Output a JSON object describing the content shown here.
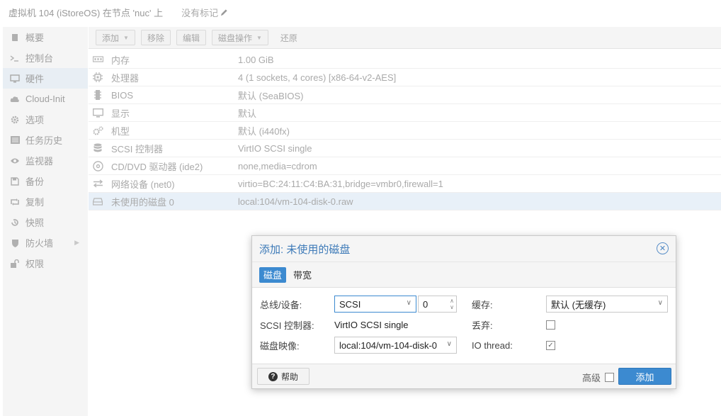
{
  "window": {
    "title": "虚拟机 104 (iStoreOS) 在节点 'nuc' 上",
    "tag_label": "没有标记"
  },
  "sidebar": {
    "items": [
      {
        "label": "概要",
        "icon": "book-icon"
      },
      {
        "label": "控制台",
        "icon": "terminal-icon"
      },
      {
        "label": "硬件",
        "icon": "monitor-icon"
      },
      {
        "label": "Cloud-Init",
        "icon": "cloud-icon"
      },
      {
        "label": "选项",
        "icon": "gear-icon"
      },
      {
        "label": "任务历史",
        "icon": "list-icon"
      },
      {
        "label": "监视器",
        "icon": "eye-icon"
      },
      {
        "label": "备份",
        "icon": "floppy-icon"
      },
      {
        "label": "复制",
        "icon": "retweet-icon"
      },
      {
        "label": "快照",
        "icon": "history-icon"
      },
      {
        "label": "防火墙",
        "icon": "shield-icon"
      },
      {
        "label": "权限",
        "icon": "unlock-icon"
      }
    ],
    "active": "硬件"
  },
  "toolbar": {
    "add_label": "添加",
    "remove_label": "移除",
    "edit_label": "编辑",
    "disk_action_label": "磁盘操作",
    "revert_label": "还原"
  },
  "hardware": {
    "rows": [
      {
        "name": "内存",
        "value": "1.00 GiB",
        "icon": "memory-icon"
      },
      {
        "name": "处理器",
        "value": "4 (1 sockets, 4 cores) [x86-64-v2-AES]",
        "icon": "cpu-icon"
      },
      {
        "name": "BIOS",
        "value": "默认 (SeaBIOS)",
        "icon": "microchip-icon"
      },
      {
        "name": "显示",
        "value": "默认",
        "icon": "desktop-icon"
      },
      {
        "name": "机型",
        "value": "默认 (i440fx)",
        "icon": "cogs-icon"
      },
      {
        "name": "SCSI 控制器",
        "value": "VirtIO SCSI single",
        "icon": "database-icon"
      },
      {
        "name": "CD/DVD 驱动器 (ide2)",
        "value": "none,media=cdrom",
        "icon": "cdrom-icon"
      },
      {
        "name": "网络设备 (net0)",
        "value": "virtio=BC:24:11:C4:BA:31,bridge=vmbr0,firewall=1",
        "icon": "exchange-icon"
      },
      {
        "name": "未使用的磁盘 0",
        "value": "local:104/vm-104-disk-0.raw",
        "icon": "hdd-icon"
      }
    ]
  },
  "dialog": {
    "title": "添加: 未使用的磁盘",
    "tabs": [
      "磁盘",
      "带宽"
    ],
    "bus_label": "总线/设备:",
    "bus_value": "SCSI",
    "device_number": "0",
    "scsi_controller_label": "SCSI 控制器:",
    "scsi_controller_value": "VirtIO SCSI single",
    "disk_image_label": "磁盘映像:",
    "disk_image_value": "local:104/vm-104-disk-0",
    "cache_label": "缓存:",
    "cache_value": "默认 (无缓存)",
    "discard_label": "丢弃:",
    "discard_checked": false,
    "iothread_label": "IO thread:",
    "iothread_checked": true,
    "help_label": "帮助",
    "advanced_label": "高级",
    "advanced_checked": false,
    "add_label": "添加"
  }
}
